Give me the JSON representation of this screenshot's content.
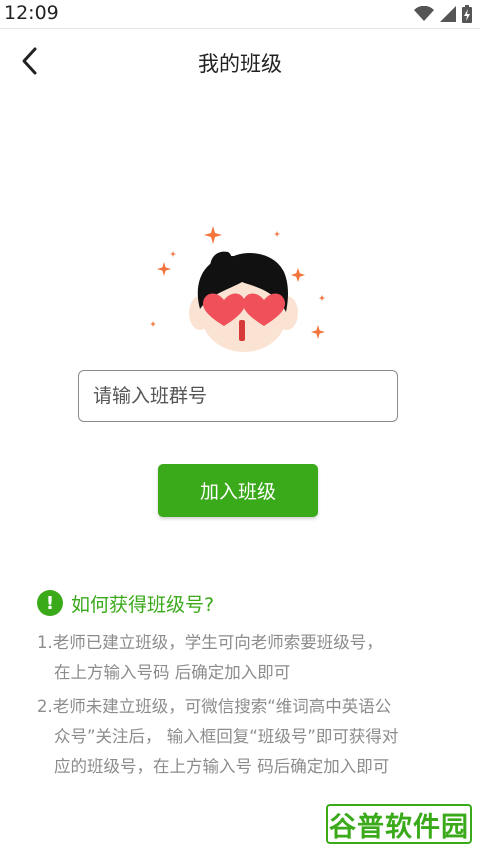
{
  "status_bar": {
    "time": "12:09",
    "icons": [
      "wifi-icon",
      "cell-signal-icon",
      "battery-charging-icon"
    ]
  },
  "header": {
    "title": "我的班级",
    "back_icon": "chevron-left-icon"
  },
  "illustration": {
    "name": "heart-eyes-mascot",
    "colors": {
      "hair": "#111111",
      "face": "#fbe3d3",
      "hearts": "#f0505a",
      "sparkles": "#f2743a"
    }
  },
  "join_form": {
    "input_placeholder": "请输入班群号",
    "input_value": "",
    "join_button_label": "加入班级"
  },
  "help": {
    "icon_glyph": "!",
    "title": "如何获得班级号?",
    "steps": [
      {
        "lines": [
          "1.老师已建立班级，学生可向老师索要班级号，",
          "在上方输入号码 后确定加入即可"
        ]
      },
      {
        "lines": [
          "2.老师未建立班级，可微信搜索“维词高中英语公",
          "众号”关注后， 输入框回复“班级号”即可获得对",
          "应的班级号，在上方输入号 码后确定加入即可"
        ]
      }
    ]
  },
  "watermark": {
    "text": "谷普软件园"
  },
  "colors": {
    "accent": "#3aaa1a",
    "text_secondary": "#8c8c8c",
    "input_border": "#8a8a8a"
  }
}
